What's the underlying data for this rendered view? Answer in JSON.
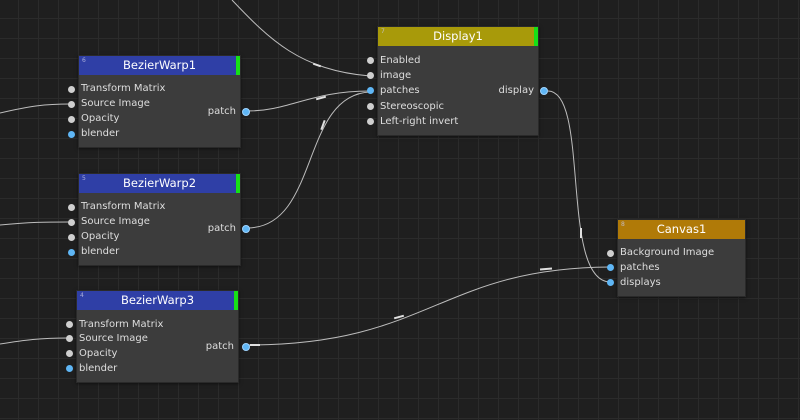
{
  "nodes": {
    "display1": {
      "id": "7",
      "title": "Display1",
      "header_color": "#a89a0a",
      "inputs": [
        "Enabled",
        "image",
        "patches",
        "Stereoscopic",
        "Left-right invert"
      ],
      "output": "display"
    },
    "bezier1": {
      "id": "6",
      "title": "BezierWarp1",
      "header_color": "#2f3fa6",
      "inputs": [
        "Transform Matrix",
        "Source Image",
        "Opacity",
        "blender"
      ],
      "output": "patch"
    },
    "bezier2": {
      "id": "5",
      "title": "BezierWarp2",
      "header_color": "#2f3fa6",
      "inputs": [
        "Transform Matrix",
        "Source Image",
        "Opacity",
        "blender"
      ],
      "output": "patch"
    },
    "bezier3": {
      "id": "4",
      "title": "BezierWarp3",
      "header_color": "#2f3fa6",
      "inputs": [
        "Transform Matrix",
        "Source Image",
        "Opacity",
        "blender"
      ],
      "output": "patch"
    },
    "canvas1": {
      "id": "8",
      "title": "Canvas1",
      "header_color": "#b07a08",
      "inputs": [
        "Background Image",
        "patches",
        "displays"
      ]
    }
  },
  "colors": {
    "port_grey": "#cfcfcf",
    "port_blue": "#5fb6f5",
    "active_indicator": "#17e017",
    "wire": "#bdbdbd"
  }
}
